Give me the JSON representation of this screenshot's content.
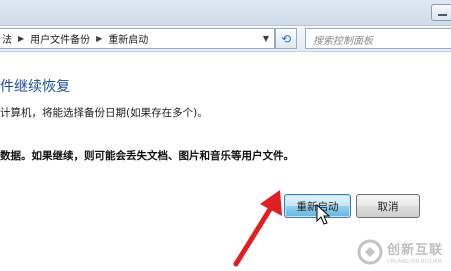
{
  "breadcrumb": {
    "items": [
      "法",
      "用户文件备份",
      "重新启动"
    ]
  },
  "search": {
    "placeholder": "搜索控制面板"
  },
  "content": {
    "heading": "件继续恢复",
    "description": "计算机，将能选择备份日期(如果存在多个)。",
    "warning": "数据。如果继续，则可能会丢失文档、图片和音乐等用户文件。"
  },
  "buttons": {
    "restart": "重新启动",
    "cancel": "取消"
  },
  "watermark": {
    "name": "创新互联",
    "tagline": "CHUANG XIN HU LIAN"
  },
  "icons": {
    "refresh": "refresh-icon",
    "search": "search-icon",
    "separator": "chevron-right-icon",
    "dropdown": "chevron-down-icon",
    "minimize": "minimize-icon",
    "cursor": "mouse-pointer-icon",
    "arrow": "red-arrow-annotation"
  },
  "colors": {
    "heading": "#1e4d9c",
    "arrow": "#e02020",
    "primary_button": "#68b3db"
  }
}
